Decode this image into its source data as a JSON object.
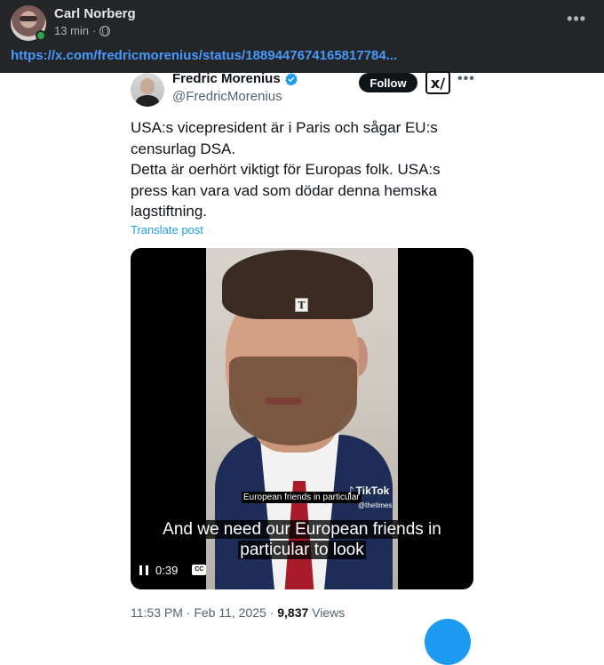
{
  "fb_post": {
    "author": "Carl Norberg",
    "time": "13 min",
    "separator": "·",
    "privacy_icon": "globe-icon",
    "more_label": "•••",
    "link": "https://x.com/fredricmorenius/status/1889447674165817784..."
  },
  "tweet": {
    "author_name": "Fredric Morenius",
    "handle": "@FredricMorenius",
    "follow_label": "Follow",
    "grok_label": "x/",
    "more_label": "•••",
    "text": "USA:s vicepresident är i Paris och sågar EU:s censurlag DSA.\nDetta är oerhört viktigt för Europas folk. USA:s press kan vara vad som dödar denna hemska lagstiftning.",
    "translate_label": "Translate post",
    "time": "11:53 PM · Feb 11, 2025 · ",
    "views_count": "9,837",
    "views_label": " Views"
  },
  "video": {
    "watermark": "T",
    "inner_caption": "European friends in particular",
    "tiktok_label": "TikTok",
    "tiktok_handle": "@thetimes",
    "subtitle_line1": "And we need our European friends in",
    "subtitle_line2": "particular to look",
    "elapsed": "0:39",
    "cc_label": "CC"
  },
  "colors": {
    "fb_bg": "#242526",
    "link": "#4599ff",
    "twitter_blue": "#1d9bf0",
    "verified": "#1d9bf0"
  }
}
